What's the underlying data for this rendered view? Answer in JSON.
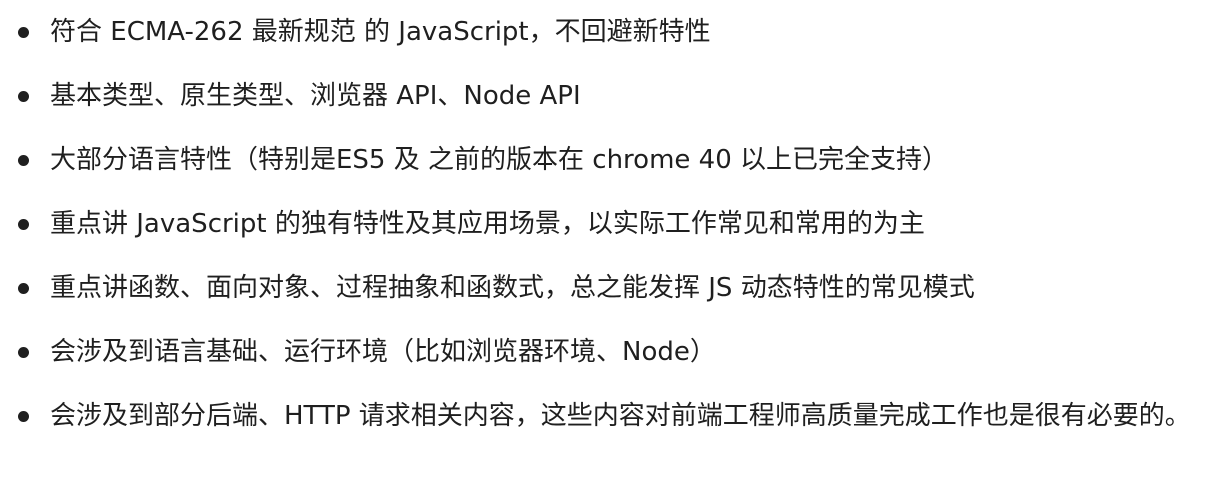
{
  "items": [
    {
      "text": "符合 ECMA-262 最新规范 的 JavaScript，不回避新特性"
    },
    {
      "text": "基本类型、原生类型、浏览器 API、Node API"
    },
    {
      "text": "大部分语言特性（特别是ES5 及 之前的版本在 chrome 40 以上已完全支持）"
    },
    {
      "text": "重点讲 JavaScript 的独有特性及其应用场景，以实际工作常见和常用的为主"
    },
    {
      "text": "重点讲函数、面向对象、过程抽象和函数式，总之能发挥 JS 动态特性的常见模式"
    },
    {
      "text": "会涉及到语言基础、运行环境（比如浏览器环境、Node）"
    },
    {
      "text": "会涉及到部分后端、HTTP 请求相关内容，这些内容对前端工程师高质量完成工作也是很有必要的。"
    }
  ]
}
